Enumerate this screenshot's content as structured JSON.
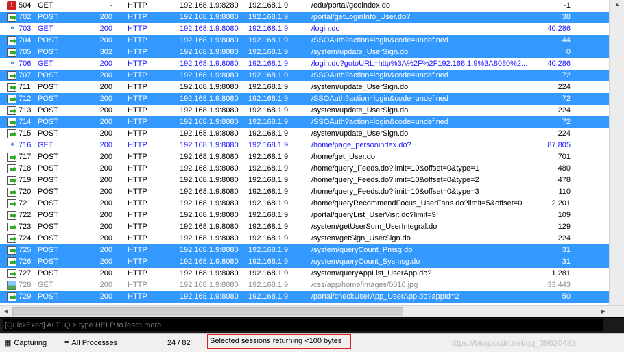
{
  "sessions": [
    {
      "num": "504",
      "method": "GET",
      "result": "-",
      "protocol": "HTTP",
      "host": "192.168.1.9:8280",
      "host_ip": "192.168.1.9",
      "url": "/edu/portal/geoindex.do",
      "body": "-1",
      "selected": false,
      "style": "normal",
      "icon": "blocked-icon"
    },
    {
      "num": "702",
      "method": "POST",
      "result": "200",
      "protocol": "HTTP",
      "host": "192.168.1.9:8080",
      "host_ip": "192.168.1.9",
      "url": "/portal/getLoginInfo_User.do?",
      "body": "38",
      "selected": true,
      "style": "normal",
      "icon": "document-icon"
    },
    {
      "num": "703",
      "method": "GET",
      "result": "200",
      "protocol": "HTTP",
      "host": "192.168.1.9:8080",
      "host_ip": "192.168.1.9",
      "url": "/login.do",
      "body": "40,286",
      "selected": false,
      "style": "blue",
      "icon": "html-arrows-icon"
    },
    {
      "num": "704",
      "method": "POST",
      "result": "200",
      "protocol": "HTTP",
      "host": "192.168.1.9:8080",
      "host_ip": "192.168.1.9",
      "url": "/SSOAuth?action=login&code=undefined",
      "body": "44",
      "selected": true,
      "style": "normal",
      "icon": "document-icon"
    },
    {
      "num": "705",
      "method": "POST",
      "result": "302",
      "protocol": "HTTP",
      "host": "192.168.1.9:8080",
      "host_ip": "192.168.1.9",
      "url": "/system/update_UserSign.do",
      "body": "0",
      "selected": true,
      "style": "normal",
      "icon": "document-icon"
    },
    {
      "num": "706",
      "method": "GET",
      "result": "200",
      "protocol": "HTTP",
      "host": "192.168.1.9:8080",
      "host_ip": "192.168.1.9",
      "url": "/login.do?gotoURL=http%3A%2F%2F192.168.1.9%3A8080%2...",
      "body": "40,286",
      "selected": false,
      "style": "blue",
      "icon": "html-arrows-icon"
    },
    {
      "num": "707",
      "method": "POST",
      "result": "200",
      "protocol": "HTTP",
      "host": "192.168.1.9:8080",
      "host_ip": "192.168.1.9",
      "url": "/SSOAuth?action=login&code=undefined",
      "body": "72",
      "selected": true,
      "style": "normal",
      "icon": "document-icon"
    },
    {
      "num": "711",
      "method": "POST",
      "result": "200",
      "protocol": "HTTP",
      "host": "192.168.1.9:8080",
      "host_ip": "192.168.1.9",
      "url": "/system/update_UserSign.do",
      "body": "224",
      "selected": false,
      "style": "normal",
      "icon": "document-icon"
    },
    {
      "num": "712",
      "method": "POST",
      "result": "200",
      "protocol": "HTTP",
      "host": "192.168.1.9:8080",
      "host_ip": "192.168.1.9",
      "url": "/SSOAuth?action=login&code=undefined",
      "body": "72",
      "selected": true,
      "style": "normal",
      "icon": "document-icon"
    },
    {
      "num": "713",
      "method": "POST",
      "result": "200",
      "protocol": "HTTP",
      "host": "192.168.1.9:8080",
      "host_ip": "192.168.1.9",
      "url": "/system/update_UserSign.do",
      "body": "224",
      "selected": false,
      "style": "normal",
      "icon": "document-icon"
    },
    {
      "num": "714",
      "method": "POST",
      "result": "200",
      "protocol": "HTTP",
      "host": "192.168.1.9:8080",
      "host_ip": "192.168.1.9",
      "url": "/SSOAuth?action=login&code=undefined",
      "body": "72",
      "selected": true,
      "style": "normal",
      "icon": "document-icon"
    },
    {
      "num": "715",
      "method": "POST",
      "result": "200",
      "protocol": "HTTP",
      "host": "192.168.1.9:8080",
      "host_ip": "192.168.1.9",
      "url": "/system/update_UserSign.do",
      "body": "224",
      "selected": false,
      "style": "normal",
      "icon": "document-icon"
    },
    {
      "num": "716",
      "method": "GET",
      "result": "200",
      "protocol": "HTTP",
      "host": "192.168.1.9:8080",
      "host_ip": "192.168.1.9",
      "url": "/home/page_personindex.do?",
      "body": "87,805",
      "selected": false,
      "style": "blue",
      "icon": "html-arrows-icon"
    },
    {
      "num": "717",
      "method": "POST",
      "result": "200",
      "protocol": "HTTP",
      "host": "192.168.1.9:8080",
      "host_ip": "192.168.1.9",
      "url": "/home/get_User.do",
      "body": "701",
      "selected": false,
      "style": "normal",
      "icon": "document-icon"
    },
    {
      "num": "718",
      "method": "POST",
      "result": "200",
      "protocol": "HTTP",
      "host": "192.168.1.9:8080",
      "host_ip": "192.168.1.9",
      "url": "/home/query_Feeds.do?limit=10&offset=0&type=1",
      "body": "480",
      "selected": false,
      "style": "normal",
      "icon": "document-icon"
    },
    {
      "num": "719",
      "method": "POST",
      "result": "200",
      "protocol": "HTTP",
      "host": "192.168.1.9:8080",
      "host_ip": "192.168.1.9",
      "url": "/home/query_Feeds.do?limit=10&offset=0&type=2",
      "body": "478",
      "selected": false,
      "style": "normal",
      "icon": "document-icon"
    },
    {
      "num": "720",
      "method": "POST",
      "result": "200",
      "protocol": "HTTP",
      "host": "192.168.1.9:8080",
      "host_ip": "192.168.1.9",
      "url": "/home/query_Feeds.do?limit=10&offset=0&type=3",
      "body": "110",
      "selected": false,
      "style": "normal",
      "icon": "document-icon"
    },
    {
      "num": "721",
      "method": "POST",
      "result": "200",
      "protocol": "HTTP",
      "host": "192.168.1.9:8080",
      "host_ip": "192.168.1.9",
      "url": "/home/queryRecommendFocus_UserFans.do?limit=5&offset=0",
      "body": "2,201",
      "selected": false,
      "style": "normal",
      "icon": "document-icon"
    },
    {
      "num": "722",
      "method": "POST",
      "result": "200",
      "protocol": "HTTP",
      "host": "192.168.1.9:8080",
      "host_ip": "192.168.1.9",
      "url": "/portal/queryList_UserVisit.do?limit=9",
      "body": "109",
      "selected": false,
      "style": "normal",
      "icon": "document-icon"
    },
    {
      "num": "723",
      "method": "POST",
      "result": "200",
      "protocol": "HTTP",
      "host": "192.168.1.9:8080",
      "host_ip": "192.168.1.9",
      "url": "/system/getUserSum_UserIntegral.do",
      "body": "129",
      "selected": false,
      "style": "normal",
      "icon": "document-icon"
    },
    {
      "num": "724",
      "method": "POST",
      "result": "200",
      "protocol": "HTTP",
      "host": "192.168.1.9:8080",
      "host_ip": "192.168.1.9",
      "url": "/system/getSign_UserSign.do",
      "body": "224",
      "selected": false,
      "style": "normal",
      "icon": "document-icon"
    },
    {
      "num": "725",
      "method": "POST",
      "result": "200",
      "protocol": "HTTP",
      "host": "192.168.1.9:8080",
      "host_ip": "192.168.1.9",
      "url": "/system/queryCount_Pmsg.do",
      "body": "31",
      "selected": true,
      "style": "normal",
      "icon": "document-icon"
    },
    {
      "num": "726",
      "method": "POST",
      "result": "200",
      "protocol": "HTTP",
      "host": "192.168.1.9:8080",
      "host_ip": "192.168.1.9",
      "url": "/system/queryCount_Sysmsg.do",
      "body": "31",
      "selected": true,
      "style": "normal",
      "icon": "document-icon"
    },
    {
      "num": "727",
      "method": "POST",
      "result": "200",
      "protocol": "HTTP",
      "host": "192.168.1.9:8080",
      "host_ip": "192.168.1.9",
      "url": "/system/queryAppList_UserApp.do?",
      "body": "1,281",
      "selected": false,
      "style": "normal",
      "icon": "document-icon"
    },
    {
      "num": "728",
      "method": "GET",
      "result": "200",
      "protocol": "HTTP",
      "host": "192.168.1.9:8080",
      "host_ip": "192.168.1.9",
      "url": "/css/app/home/images/0016.jpg",
      "body": "33,443",
      "selected": false,
      "style": "gray",
      "icon": "image-icon"
    },
    {
      "num": "729",
      "method": "POST",
      "result": "200",
      "protocol": "HTTP",
      "host": "192.168.1.9:8080",
      "host_ip": "192.168.1.9",
      "url": "/portal/checkUserApp_UserApp.do?appId=2",
      "body": "50",
      "selected": true,
      "style": "normal",
      "icon": "document-icon"
    }
  ],
  "quickexec": {
    "placeholder": "[QuickExec] ALT+Q > type HELP to learn more",
    "value": ""
  },
  "status": {
    "capture_label": "Capturing",
    "filter_label": "All Processes",
    "count": "24 / 82",
    "message": "Selected sessions returning <100 bytes",
    "watermark": "https://blog.csdn.net/qq_39620483"
  },
  "colors": {
    "selection": "#3399ff",
    "html_text": "#1a1aff",
    "image_text": "#8a8a8a",
    "highlight_border": "#e02020"
  },
  "icons": {
    "capture": "capture-icon",
    "filter": "funnel-icon",
    "scroll_up": "scroll-up-arrow-icon",
    "scroll_left": "scroll-left-arrow-icon",
    "scroll_right": "scroll-right-arrow-icon"
  }
}
